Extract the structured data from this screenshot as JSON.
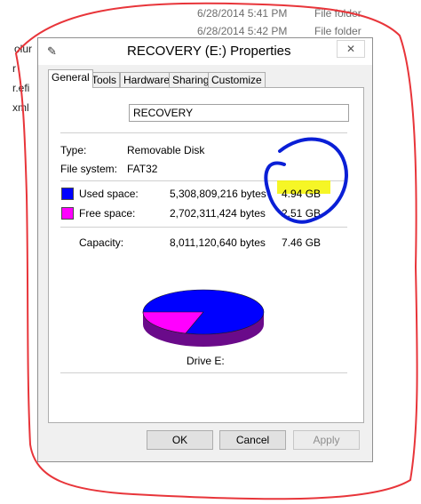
{
  "background": {
    "rows": [
      {
        "date": "6/28/2014 5:41 PM",
        "type": "File folder"
      },
      {
        "date": "6/28/2014 5:42 PM",
        "type": "File folder"
      }
    ],
    "left_fragments": [
      "olur",
      "r",
      "r.efi",
      "xml"
    ]
  },
  "dialog": {
    "title": "RECOVERY (E:) Properties",
    "close_glyph": "✕",
    "tabs": [
      "General",
      "Tools",
      "Hardware",
      "Sharing",
      "Customize"
    ],
    "active_tab": "General",
    "general": {
      "name_value": "RECOVERY",
      "type_label": "Type:",
      "type_value": "Removable Disk",
      "fs_label": "File system:",
      "fs_value": "FAT32",
      "used": {
        "label": "Used space:",
        "bytes": "5,308,809,216 bytes",
        "size": "4.94 GB",
        "color": "#0000ff"
      },
      "free": {
        "label": "Free space:",
        "bytes": "2,702,311,424 bytes",
        "size": "2.51 GB",
        "color": "#ff00ff"
      },
      "capacity": {
        "label": "Capacity:",
        "bytes": "8,011,120,640 bytes",
        "size": "7.46 GB"
      },
      "drive_label": "Drive E:"
    },
    "buttons": {
      "ok": "OK",
      "cancel": "Cancel",
      "apply": "Apply"
    }
  },
  "annotations": {
    "highlight_color": "#f5f500",
    "circle_color": "#0a1fd6",
    "outline_color": "#e8353a"
  }
}
